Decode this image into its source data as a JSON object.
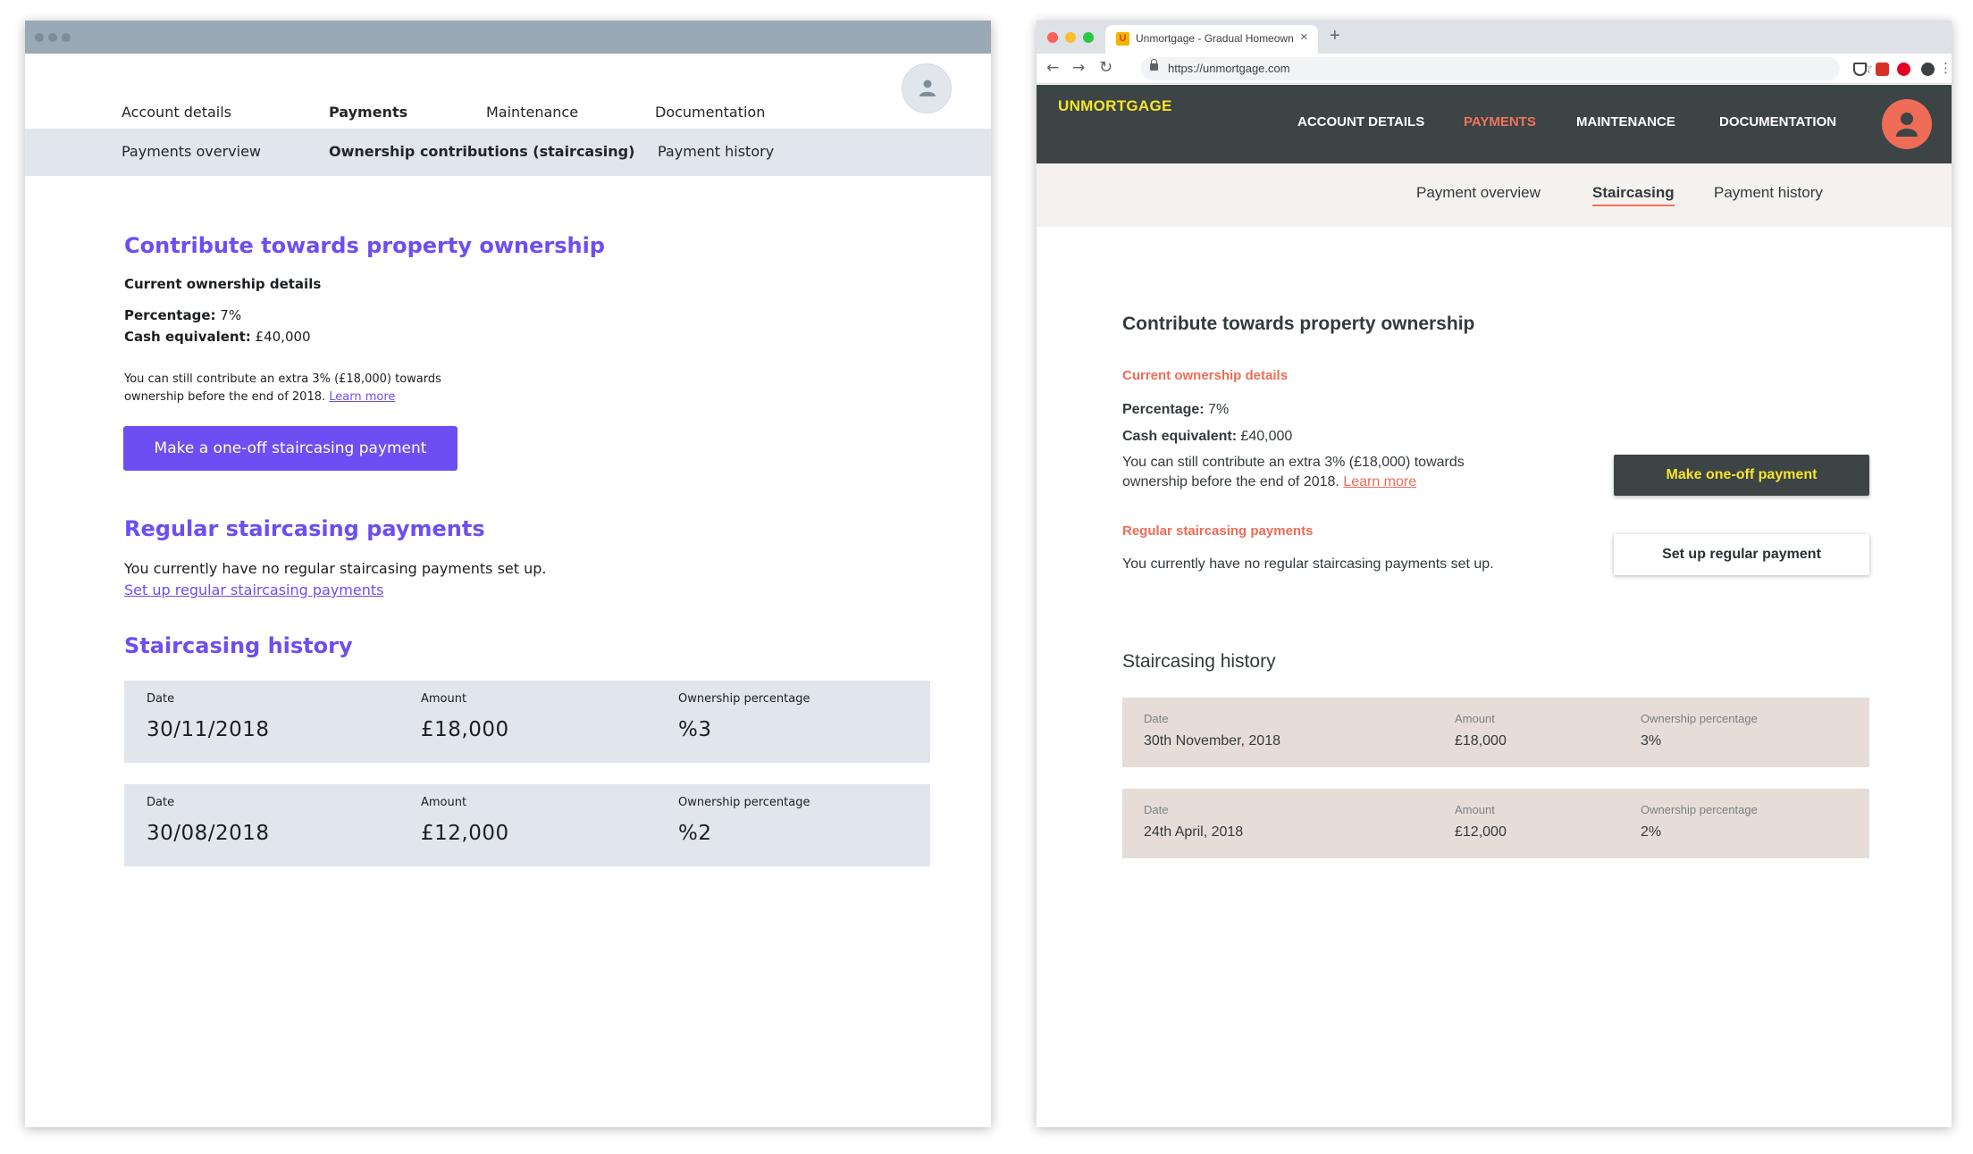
{
  "wireframe": {
    "nav": {
      "account_details": "Account details",
      "payments": "Payments",
      "maintenance": "Maintenance",
      "documentation": "Documentation"
    },
    "subnav": {
      "overview": "Payments overview",
      "staircasing": "Ownership contributions (staircasing)",
      "history": "Payment history"
    },
    "contribute": {
      "heading": "Contribute towards property ownership",
      "subheading": "Current ownership details",
      "percentage_label": "Percentage:",
      "percentage_value": "7%",
      "cash_label": "Cash equivalent:",
      "cash_value": "£40,000",
      "note_line1": "You can still contribute an extra 3% (£18,000) towards",
      "note_line2": "ownership before the end of 2018.",
      "learn_more": "Learn more",
      "button": "Make a one-off staircasing payment"
    },
    "regular": {
      "heading": "Regular staircasing payments",
      "text": "You currently have no regular staircasing payments set up.",
      "link": "Set up regular staircasing payments"
    },
    "history": {
      "heading": "Staircasing history",
      "col_date": "Date",
      "col_amount": "Amount",
      "col_pct": "Ownership percentage",
      "rows": [
        {
          "date": "30/11/2018",
          "amount": "£18,000",
          "pct": "%3"
        },
        {
          "date": "30/08/2018",
          "amount": "£12,000",
          "pct": "%2"
        }
      ]
    }
  },
  "browser": {
    "tab_title": "Unmortgage - Gradual Homeownership",
    "tab_close": "×",
    "favicon": "U",
    "new_tab": "+",
    "url": "https://unmortgage.com",
    "nav_buttons": {
      "back": "←",
      "forward": "→",
      "reload": "↻",
      "star": "☆",
      "menu": "⋮"
    },
    "colors": {
      "header": "#3c4446",
      "brand": "#f7e52a",
      "accent": "#ef6c57",
      "card": "#e6ddd9"
    },
    "brand": "UNMORTGAGE",
    "nav": {
      "account_details": "ACCOUNT DETAILS",
      "payments": "PAYMENTS",
      "maintenance": "MAINTENANCE",
      "documentation": "DOCUMENTATION"
    },
    "subnav": {
      "overview": "Payment overview",
      "staircasing": "Staircasing",
      "history": "Payment history"
    },
    "contribute": {
      "heading": "Contribute towards property ownership",
      "subheading": "Current ownership details",
      "percentage_label": "Percentage:",
      "percentage_value": "7%",
      "cash_label": "Cash equivalent:",
      "cash_value": "£40,000",
      "note_line1": "You can still contribute an extra 3% (£18,000) towards",
      "note_line2": "ownership before the end of 2018.",
      "learn_more": "Learn more",
      "button": "Make one-off payment"
    },
    "regular": {
      "heading": "Regular staircasing payments",
      "text": "You currently have no regular staircasing payments set up.",
      "button": "Set up regular payment"
    },
    "history": {
      "heading": "Staircasing history",
      "col_date": "Date",
      "col_amount": "Amount",
      "col_pct": "Ownership percentage",
      "rows": [
        {
          "date": "30th November, 2018",
          "amount": "£18,000",
          "pct": "3%"
        },
        {
          "date": "24th April, 2018",
          "amount": "£12,000",
          "pct": "2%"
        }
      ]
    }
  }
}
